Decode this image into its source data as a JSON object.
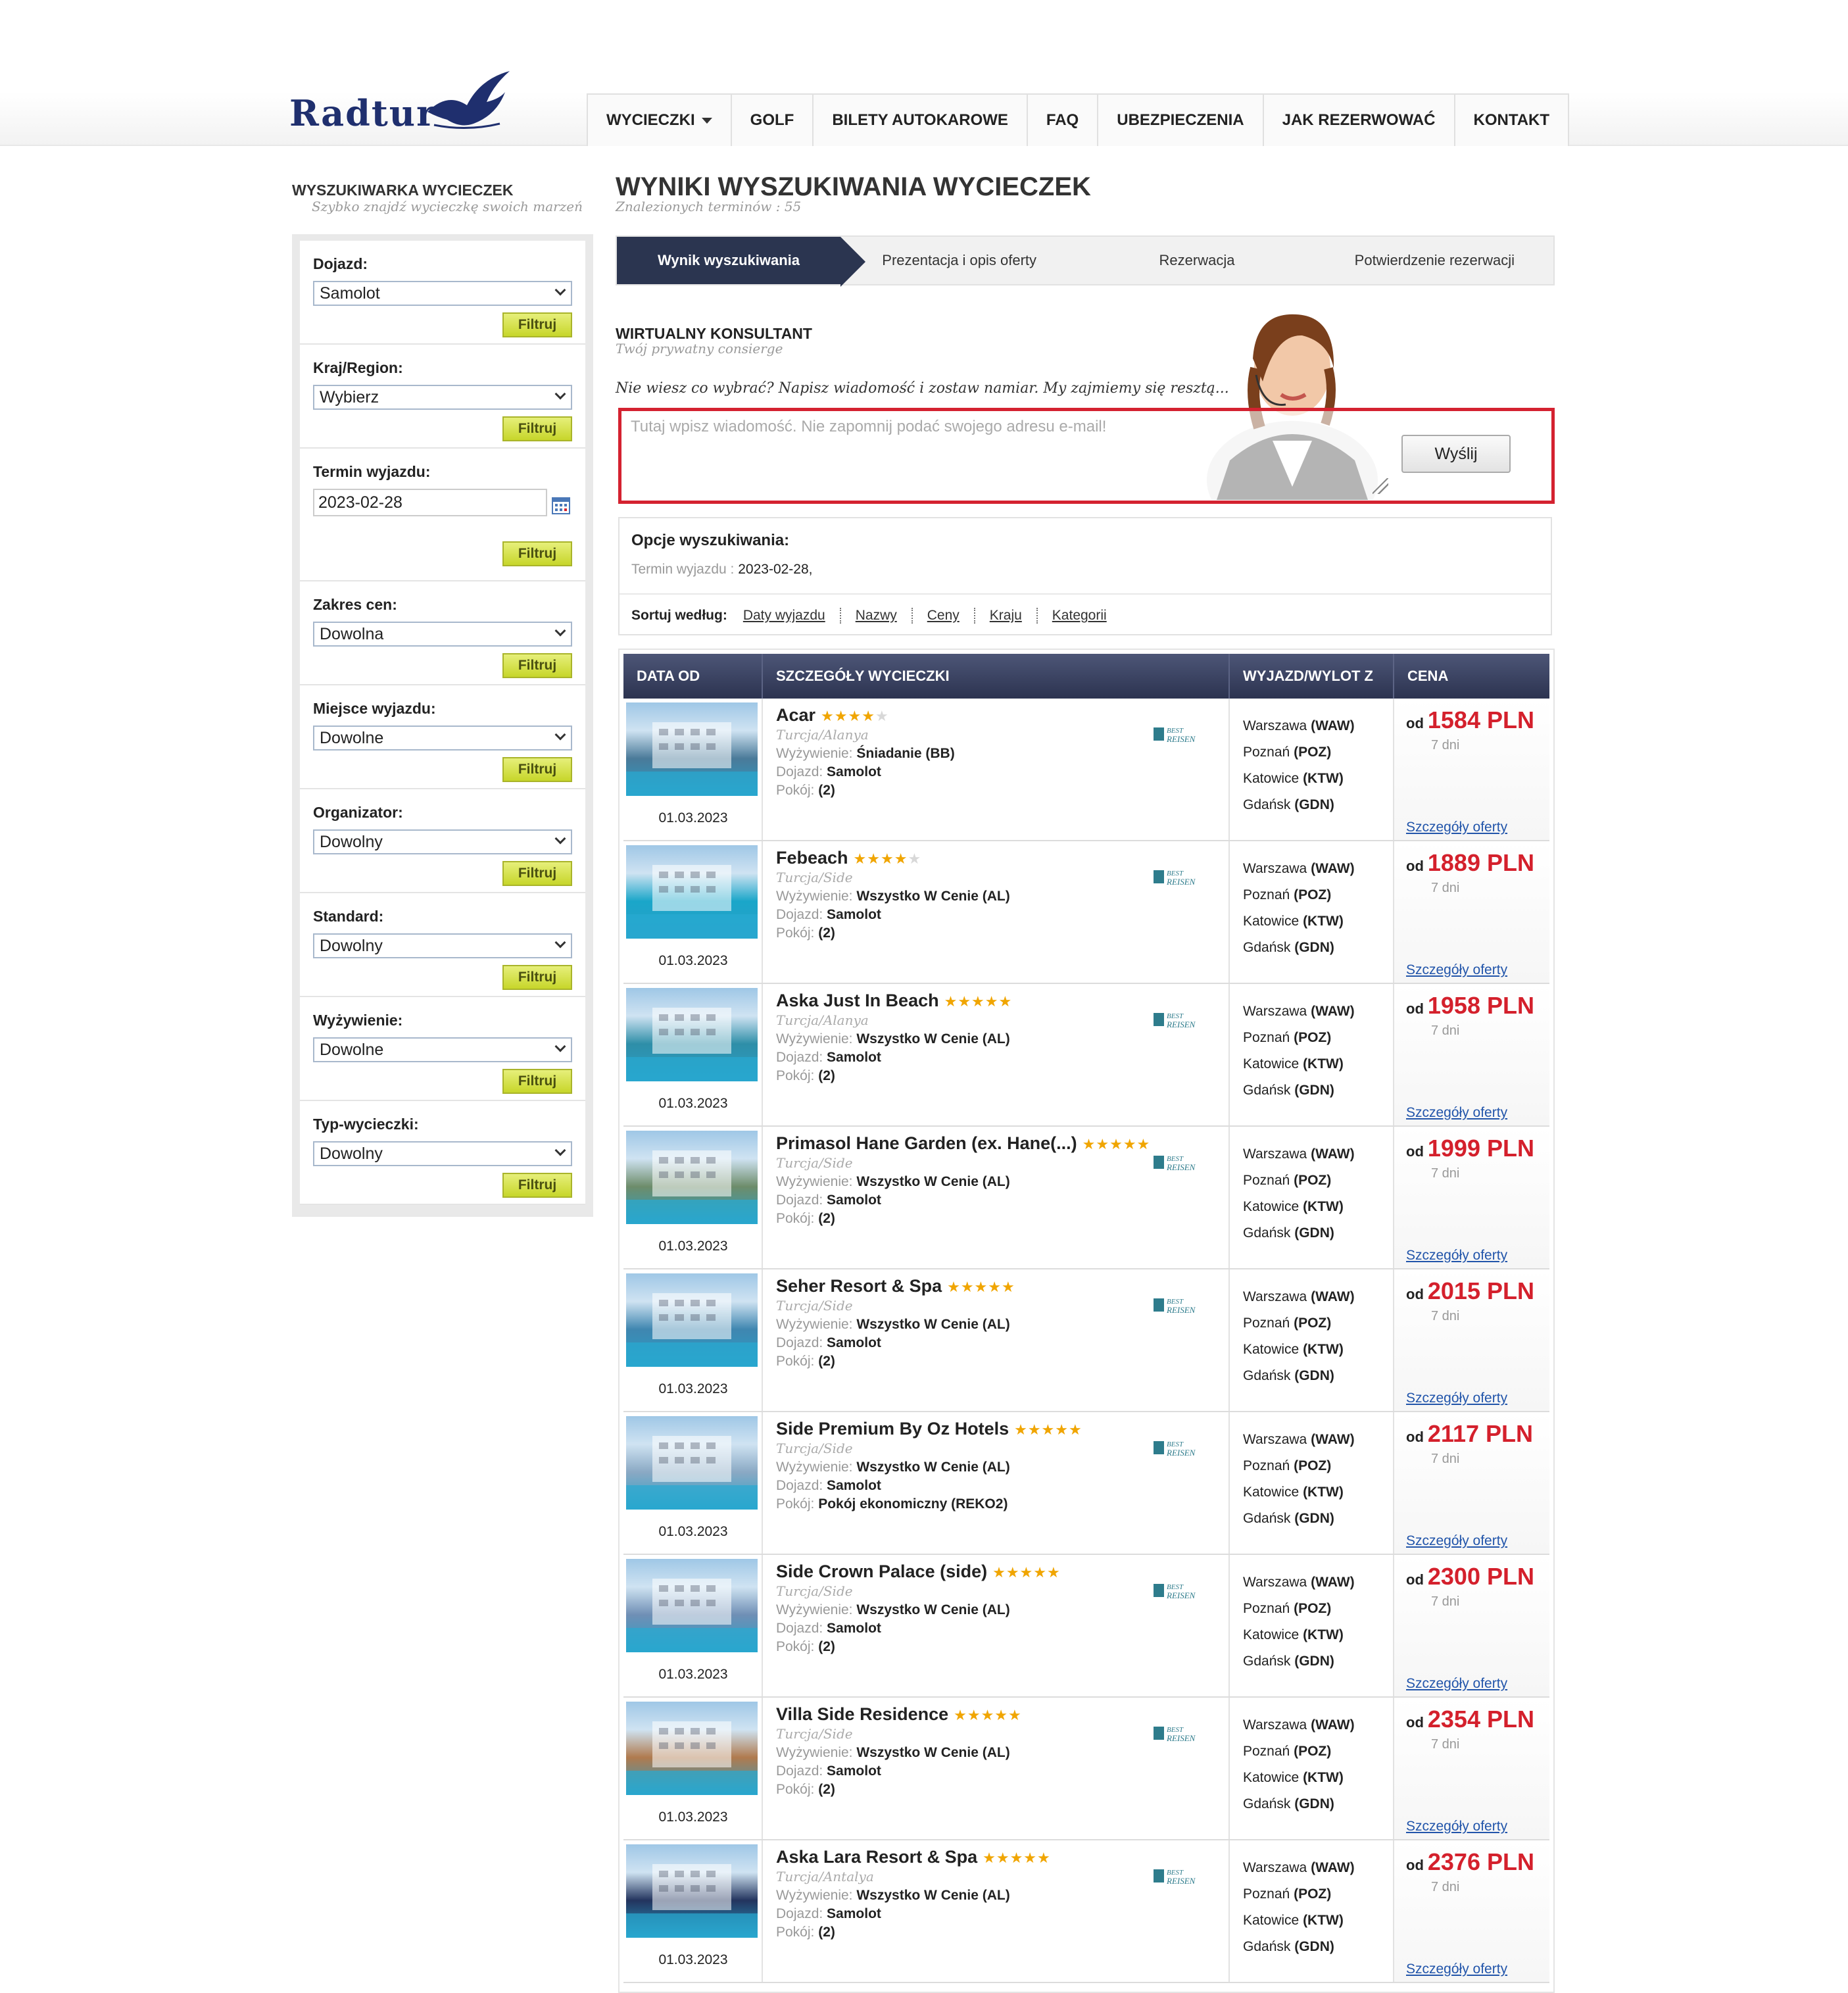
{
  "logo": {
    "text": "Radtur"
  },
  "nav": [
    {
      "label": "WYCIECZKI",
      "dropdown": true
    },
    {
      "label": "GOLF"
    },
    {
      "label": "BILETY AUTOKAROWE"
    },
    {
      "label": "FAQ"
    },
    {
      "label": "UBEZPIECZENIA"
    },
    {
      "label": "JAK REZERWOWAĆ"
    },
    {
      "label": "KONTAKT"
    }
  ],
  "sidebar": {
    "title": "WYSZUKIWARKA WYCIECZEK",
    "subtitle": "Szybko znajdź wycieczkę swoich marzeń",
    "button_label": "Filtruj",
    "filters": [
      {
        "label": "Dojazd:",
        "value": "Samolot"
      },
      {
        "label": "Kraj/Region:",
        "value": "Wybierz"
      },
      {
        "label": "Termin wyjazdu:",
        "value": "2023-02-28",
        "type": "date"
      },
      {
        "label": "Zakres cen:",
        "value": "Dowolna"
      },
      {
        "label": "Miejsce wyjazdu:",
        "value": "Dowolne"
      },
      {
        "label": "Organizator:",
        "value": "Dowolny"
      },
      {
        "label": "Standard:",
        "value": "Dowolny"
      },
      {
        "label": "Wyżywienie:",
        "value": "Dowolne"
      },
      {
        "label": "Typ-wycieczki:",
        "value": "Dowolny"
      }
    ]
  },
  "main": {
    "title": "WYNIKI WYSZUKIWANIA WYCIECZEK",
    "subtitle": "Znalezionych terminów : 55",
    "steps": [
      "Wynik wyszukiwania",
      "Prezentacja i opis oferty",
      "Rezerwacja",
      "Potwierdzenie rezerwacji"
    ]
  },
  "consultant": {
    "title": "WIRTUALNY KONSULTANT",
    "subtitle": "Twój prywatny consierge",
    "question": "Nie wiesz co wybrać? Napisz wiadomość i zostaw namiar. My zajmiemy się resztą...",
    "placeholder": "Tutaj wpisz wiadomość. Nie zapomnij podać swojego adresu e-mail!",
    "send_label": "Wyślij"
  },
  "options": {
    "title": "Opcje wyszukiwania:",
    "term_label": "Termin wyjazdu :",
    "term_value": "2023-02-28,",
    "sort_label": "Sortuj według:",
    "sort_links": [
      "Daty wyjazdu",
      "Nazwy",
      "Ceny",
      "Kraju",
      "Kategorii"
    ]
  },
  "table": {
    "headers": [
      "DATA OD",
      "SZCZEGÓŁY WYCIECZKI",
      "WYJAZD/WYLOT Z",
      "CENA"
    ],
    "labels": {
      "meal": "Wyżywienie:",
      "transport": "Dojazd:",
      "room": "Pokój:",
      "price_prefix": "od",
      "details": "Szczegóły oferty"
    },
    "brand_text": "BEST REISEN",
    "departures": [
      {
        "city": "Warszawa",
        "code": "(WAW)"
      },
      {
        "city": "Poznań",
        "code": "(POZ)"
      },
      {
        "city": "Katowice",
        "code": "(KTW)"
      },
      {
        "city": "Gdańsk",
        "code": "(GDN)"
      }
    ],
    "rows": [
      {
        "date": "01.03.2023",
        "name": "Acar",
        "stars": 4,
        "region": "Turcja/Alanya",
        "meal": "Śniadanie (BB)",
        "transport": "Samolot",
        "room": "(2)",
        "price": "1584 PLN",
        "days": "7 dni",
        "img": "#4a7a99"
      },
      {
        "date": "01.03.2023",
        "name": "Febeach",
        "stars": 4,
        "region": "Turcja/Side",
        "meal": "Wszystko W Cenie (AL)",
        "transport": "Samolot",
        "room": "(2)",
        "price": "1889 PLN",
        "days": "7 dni",
        "img": "#1aa6c9"
      },
      {
        "date": "01.03.2023",
        "name": "Aska Just In Beach",
        "stars": 5,
        "region": "Turcja/Alanya",
        "meal": "Wszystko W Cenie (AL)",
        "transport": "Samolot",
        "room": "(2)",
        "price": "1958 PLN",
        "days": "7 dni",
        "img": "#2e8ea8"
      },
      {
        "date": "01.03.2023",
        "name": "Primasol Hane Garden (ex. Hane(...)",
        "stars": 5,
        "region": "Turcja/Side",
        "meal": "Wszystko W Cenie (AL)",
        "transport": "Samolot",
        "room": "(2)",
        "price": "1999 PLN",
        "days": "7 dni",
        "img": "#6d8c6a"
      },
      {
        "date": "01.03.2023",
        "name": "Seher Resort & Spa",
        "stars": 5,
        "region": "Turcja/Side",
        "meal": "Wszystko W Cenie (AL)",
        "transport": "Samolot",
        "room": "(2)",
        "price": "2015 PLN",
        "days": "7 dni",
        "img": "#3f86b0"
      },
      {
        "date": "01.03.2023",
        "name": "Side Premium By Oz Hotels",
        "stars": 5,
        "region": "Turcja/Side",
        "meal": "Wszystko W Cenie (AL)",
        "transport": "Samolot",
        "room": "Pokój ekonomiczny (REKO2)",
        "price": "2117 PLN",
        "days": "7 dni",
        "img": "#8aa9c4"
      },
      {
        "date": "01.03.2023",
        "name": "Side Crown Palace (side)",
        "stars": 5,
        "region": "Turcja/Side",
        "meal": "Wszystko W Cenie (AL)",
        "transport": "Samolot",
        "room": "(2)",
        "price": "2300 PLN",
        "days": "7 dni",
        "img": "#6f8fb5"
      },
      {
        "date": "01.03.2023",
        "name": "Villa Side Residence",
        "stars": 5,
        "region": "Turcja/Side",
        "meal": "Wszystko W Cenie (AL)",
        "transport": "Samolot",
        "room": "(2)",
        "price": "2354 PLN",
        "days": "7 dni",
        "img": "#b07a4e"
      },
      {
        "date": "01.03.2023",
        "name": "Aska Lara Resort & Spa",
        "stars": 5,
        "region": "Turcja/Antalya",
        "meal": "Wszystko W Cenie (AL)",
        "transport": "Samolot",
        "room": "(2)",
        "price": "2376 PLN",
        "days": "7 dni",
        "img": "#23345e"
      }
    ]
  }
}
